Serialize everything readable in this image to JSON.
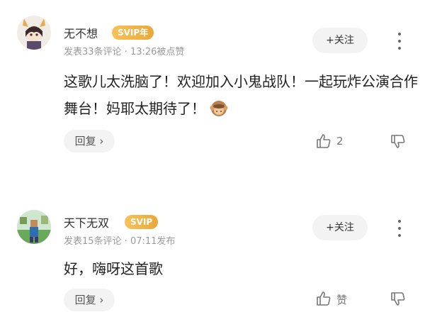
{
  "comments": [
    {
      "username": "无不想",
      "badge": "SVIP年",
      "meta": "发表33条评论 · 13:26被点赞",
      "follow_label": "+关注",
      "text": "这歌儿太洗脑了！欢迎加入小鬼战队！一起玩炸公演合作舞台！妈耶太期待了！",
      "emoji": "monkey-icon",
      "reply_label": "回复 ›",
      "like_label": "2"
    },
    {
      "username": "天下无双",
      "badge": "SVIP",
      "meta": "发表15条评论 · 07:11发布",
      "follow_label": "+关注",
      "text": "好，嗨呀这首歌",
      "reply_label": "回复 ›",
      "like_label": "赞"
    }
  ],
  "colors": {
    "badge": "#eeb04a",
    "meta": "#9a9a9a",
    "button_bg": "#f3f3f3"
  }
}
